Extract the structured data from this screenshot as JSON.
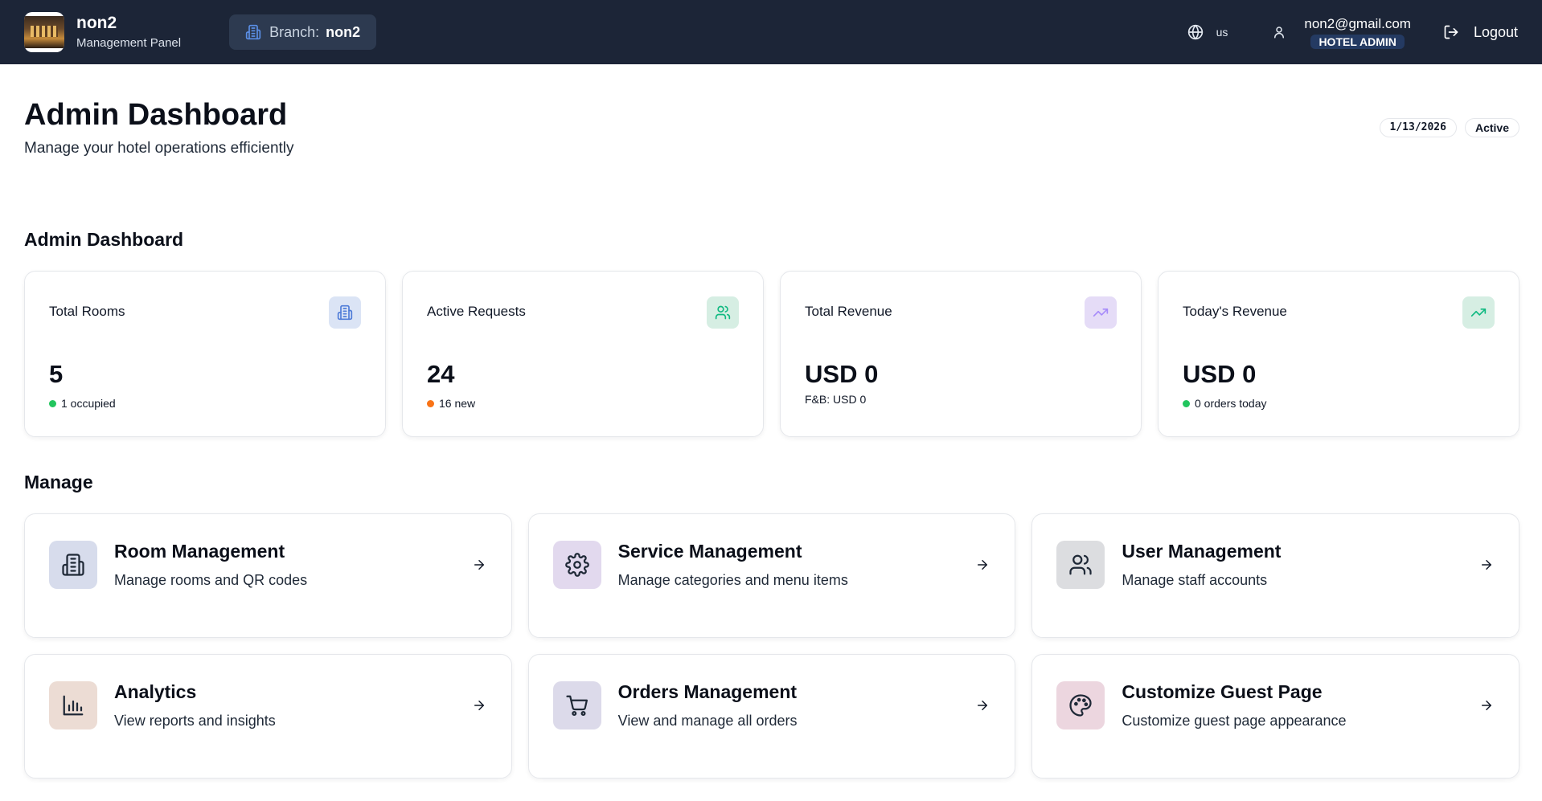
{
  "header": {
    "brand_name": "non2",
    "brand_subtitle": "Management Panel",
    "branch_label": "Branch:",
    "branch_value": "non2",
    "language": "us",
    "user_email": "non2@gmail.com",
    "user_role": "HOTEL ADMIN",
    "logout_label": "Logout",
    "bg_color": "#1c2537"
  },
  "page": {
    "title": "Admin Dashboard",
    "subtitle": "Manage your hotel operations efficiently",
    "date": "1/13/2026",
    "status": "Active"
  },
  "stats": {
    "section_title": "Admin Dashboard",
    "cards": [
      {
        "label": "Total Rooms",
        "value": "5",
        "sub": "1 occupied",
        "dot_color": "#22c55e",
        "icon": "building-icon",
        "icon_bg": "#dbe4f5",
        "icon_color": "#4f7cd8"
      },
      {
        "label": "Active Requests",
        "value": "24",
        "sub": "16 new",
        "dot_color": "#f97316",
        "icon": "users-icon",
        "icon_bg": "#d6eee3",
        "icon_color": "#10b981"
      },
      {
        "label": "Total Revenue",
        "value": "USD 0",
        "sub": "F&B: USD 0",
        "icon": "trending-up-icon",
        "icon_bg": "#e5dcf7",
        "icon_color": "#a78bfa"
      },
      {
        "label": "Today's Revenue",
        "value": "USD 0",
        "sub": "0 orders today",
        "dot_color": "#22c55e",
        "icon": "trending-up-icon",
        "icon_bg": "#d6eee3",
        "icon_color": "#10b981"
      }
    ]
  },
  "manage": {
    "section_title": "Manage",
    "cards": [
      {
        "title": "Room Management",
        "desc": "Manage rooms and QR codes",
        "icon": "building-icon",
        "icon_bg": "#d7dcec"
      },
      {
        "title": "Service Management",
        "desc": "Manage categories and menu items",
        "icon": "gear-icon",
        "icon_bg": "#e2d9ee"
      },
      {
        "title": "User Management",
        "desc": "Manage staff accounts",
        "icon": "users-icon",
        "icon_bg": "#dcdde0"
      },
      {
        "title": "Analytics",
        "desc": "View reports and insights",
        "icon": "bar-chart-icon",
        "icon_bg": "#ecdcd4"
      },
      {
        "title": "Orders Management",
        "desc": "View and manage all orders",
        "icon": "cart-icon",
        "icon_bg": "#dcdaea"
      },
      {
        "title": "Customize Guest Page",
        "desc": "Customize guest page appearance",
        "icon": "palette-icon",
        "icon_bg": "#ecd6df"
      }
    ]
  }
}
